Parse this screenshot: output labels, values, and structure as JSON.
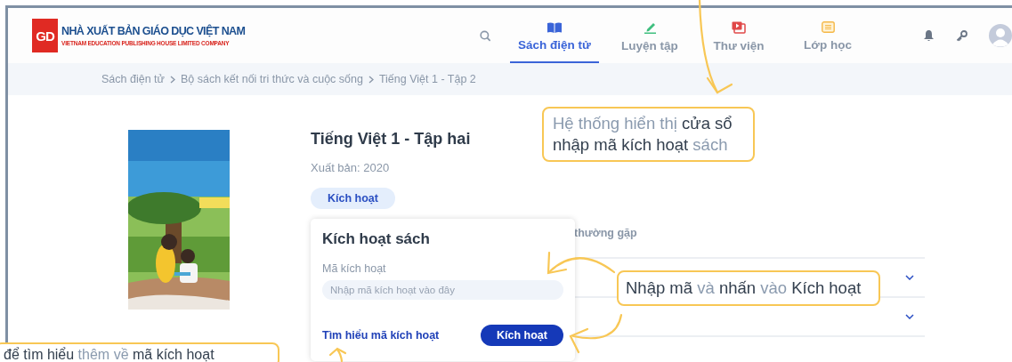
{
  "brand": {
    "mark": "GD",
    "name": "NHÀ XUẤT BẢN GIÁO DỤC VIỆT NAM",
    "subtitle": "VIETNAM EDUCATION PUBLISHING HOUSE LIMITED COMPANY"
  },
  "nav": [
    {
      "label": "Sách điện tử",
      "kind": "book",
      "selected": true
    },
    {
      "label": "Luyện tập",
      "kind": "pencil",
      "selected": false
    },
    {
      "label": "Thư viện",
      "kind": "video",
      "selected": false
    },
    {
      "label": "Lớp học",
      "kind": "list",
      "selected": false
    }
  ],
  "breadcrumb": [
    "Sách điện tử",
    "Bộ sách kết nối tri thức và cuộc sống",
    "Tiếng Việt 1 - Tập 2"
  ],
  "book": {
    "title": "Tiếng Việt 1 - Tập hai",
    "published": "Xuất bản: 2020",
    "activate_button": "Kích hoạt"
  },
  "tab_label": "thường gặp",
  "faq_rows": [
    {
      "expanded": false
    },
    {
      "expanded": false
    }
  ],
  "dialog": {
    "title": "Kích hoạt sách",
    "field_label": "Mã kích hoạt",
    "placeholder": "Nhập mã kích hoạt vào đây",
    "link": "Tìm hiểu mã kích hoạt",
    "button": "Kích hoạt"
  },
  "callouts": [
    {
      "parts": [
        {
          "text": "Hệ thống hiển thị",
          "emphasis": false
        },
        {
          "text": "cửa sổ nhập mã kích hoạt",
          "emphasis": true
        },
        {
          "text": "sách",
          "emphasis": false
        }
      ]
    },
    {
      "parts": [
        {
          "text": "Nhập mã",
          "emphasis": true
        },
        {
          "text": "và",
          "emphasis": false
        },
        {
          "text": "nhấn",
          "emphasis": true
        },
        {
          "text": "vào",
          "emphasis": false
        },
        {
          "text": "Kích hoạt",
          "emphasis": true
        }
      ]
    },
    {
      "parts": [
        {
          "text": "để tìm hiểu",
          "emphasis": true
        },
        {
          "text": "thêm về",
          "emphasis": false
        },
        {
          "text": "mã kích hoạt",
          "emphasis": true
        }
      ]
    }
  ]
}
